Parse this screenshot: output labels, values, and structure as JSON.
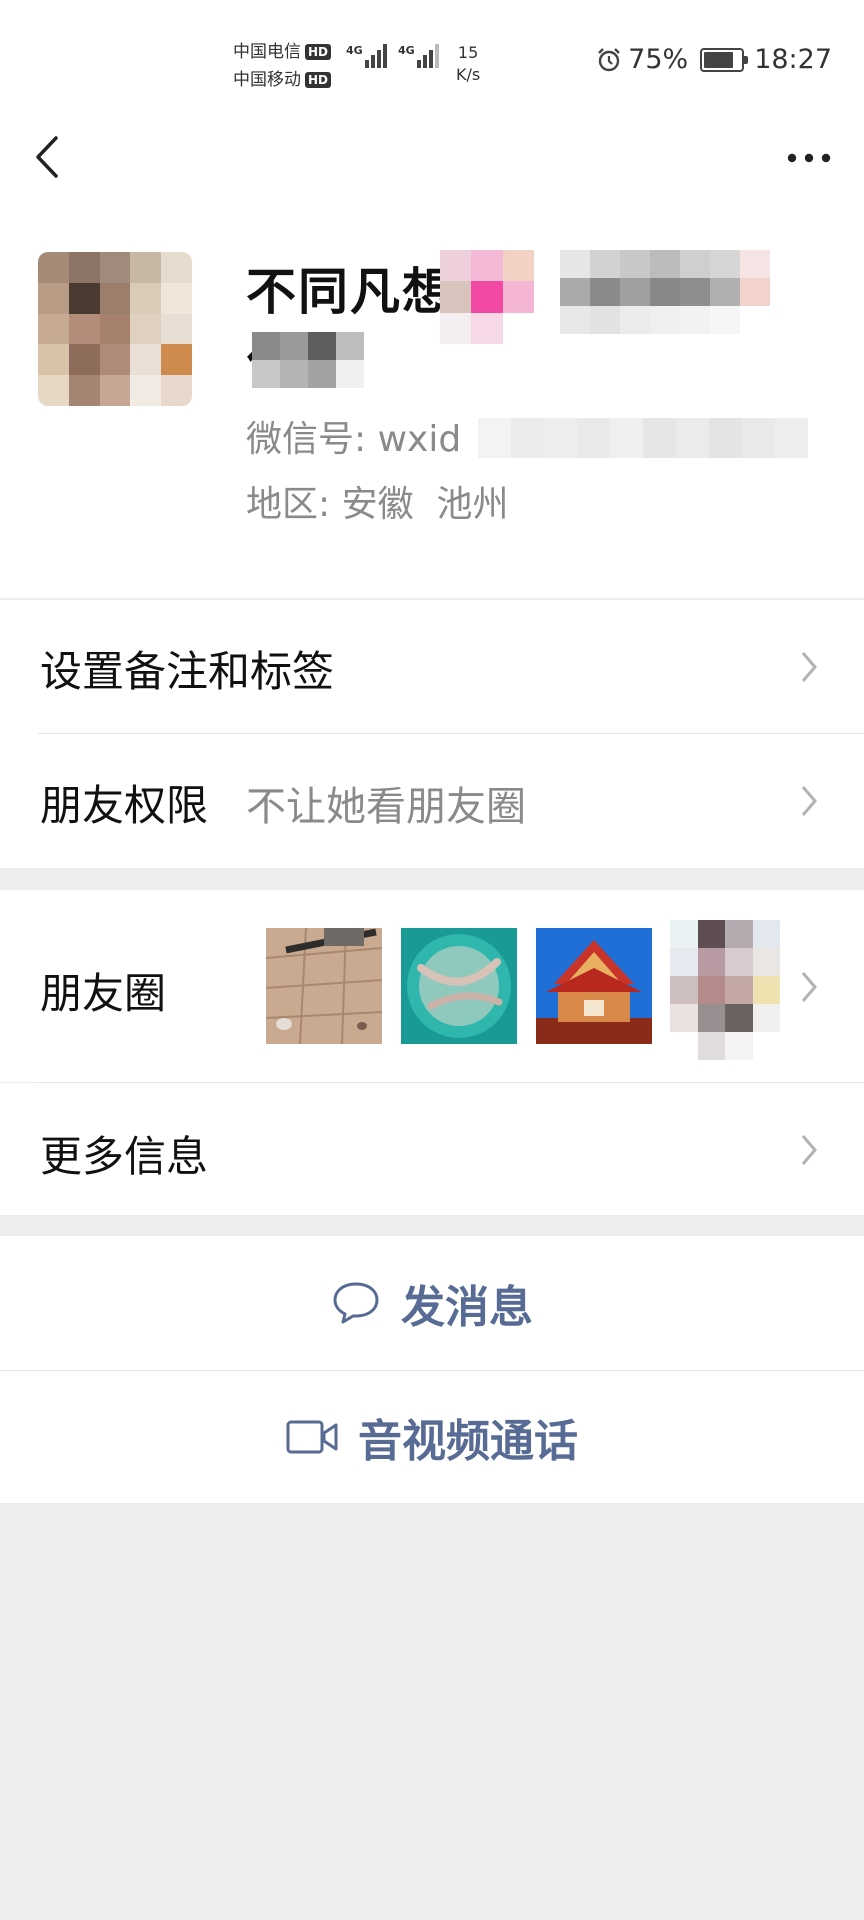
{
  "status_bar": {
    "carrier1": "中国电信",
    "carrier2": "中国移动",
    "hd_badge": "HD",
    "network1": "4G",
    "network2": "4G",
    "speed_value": "15",
    "speed_unit": "K/s",
    "battery": "75%",
    "time": "18:27"
  },
  "profile": {
    "name_line1": "不同凡想",
    "name_line2": "化",
    "wechat_id": "微信号: wxid",
    "region": "地区: 安徽  池州"
  },
  "menu": {
    "remark": "设置备注和标签",
    "permission_label": "朋友权限",
    "permission_value": "不让她看朋友圈",
    "moments": "朋友圈",
    "more_info": "更多信息"
  },
  "actions": {
    "message": "发消息",
    "video_call": "音视频通话"
  },
  "colors": {
    "link_blue": "#576b95",
    "page_bg": "#ededed",
    "secondary_text": "#8a8a8a"
  }
}
